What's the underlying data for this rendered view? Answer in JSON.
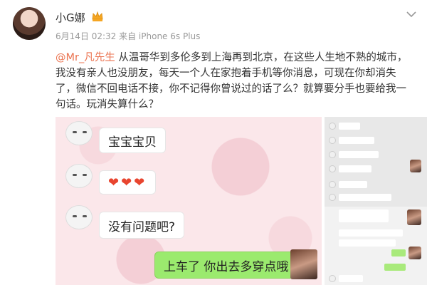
{
  "post": {
    "username": "小G娜",
    "meta": "6月14日 02:32 来自 iPhone 6s Plus",
    "mention": "@Mr_凡先生",
    "body": " 从温哥华到多伦多到上海再到北京，在这些人生地不熟的城市，我没有亲人也没朋友，每天一个人在家抱着手机等你消息，可现在你却消失了，微信不回电话不接，你不记得你曾说过的话了么？就算要分手也要给我一句话。玩消失算什么？"
  },
  "chat": {
    "bubble1": "宝宝宝贝",
    "bubble2": "❤❤❤",
    "bubble3": "没有问题吧?",
    "bubble4": "上车了 你出去多穿点哦"
  },
  "colors": {
    "mention": "#eb7350",
    "wechat_green": "#9bea6e"
  },
  "icons": [
    "vip-crown-icon",
    "chevron-down-icon"
  ]
}
